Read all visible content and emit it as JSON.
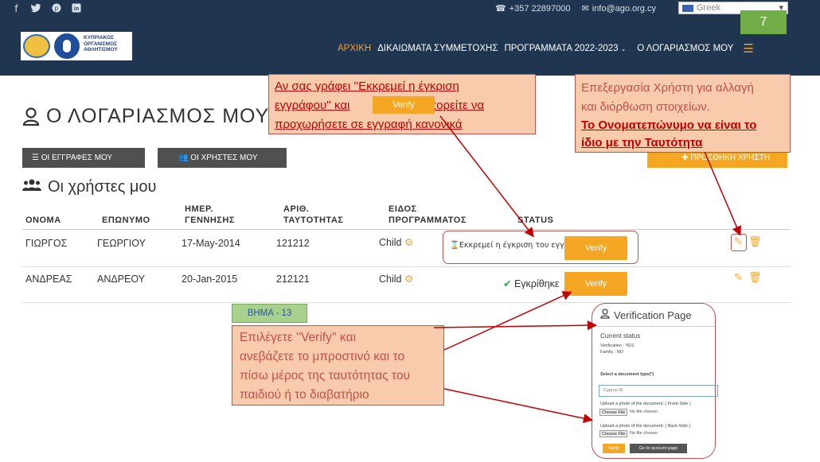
{
  "topbar": {
    "social": [
      "f",
      "🐦",
      "P",
      "in"
    ],
    "phone": "+357 22897000",
    "email": "info@ago.org.cy",
    "language": "Greek",
    "slide_number": "7"
  },
  "logo": {
    "text": "ΚΥΠΡΙΑΚΟΣ ΟΡΓΑΝΙΣΜΟΣ ΑΘΛΗΤΙΣΜΟΥ"
  },
  "nav": {
    "home": "ΑΡΧΙΚΗ",
    "rights": "ΔΙΚΑΙΩΜΑΤΑ ΣΥΜΜΕΤΟΧΗΣ",
    "programs": "ΠΡΟΓΡΑΜΜΑΤΑ 2022-2023",
    "account": "Ο ΛΟΓΑΡΙΑΣΜΟΣ ΜΟΥ"
  },
  "page": {
    "title": "Ο ΛΟΓΑΡΙΑΣΜΟΣ ΜΟΥ",
    "my_registrations": "ΟΙ ΕΓΓΡΑΦΕΣ ΜΟΥ",
    "my_users": "ΟΙ ΧΡΗΣΤΕΣ ΜΟΥ",
    "add_user": "ΠΡΟΣΘΗΚΗ ΧΡΗΣΤΗ",
    "section_title": "Οι χρήστες μου"
  },
  "table": {
    "headers": {
      "name": "ΟΝΟΜΑ",
      "surname": "ΕΠΩΝΥΜΟ",
      "birth1": "ΗΜΕΡ.",
      "birth2": "ΓΕΝΝΗΣΗΣ",
      "id1": "ΑΡΙΘ.",
      "id2": "ΤΑΥΤΟΤΗΤΑΣ",
      "program1": "ΕΙΔΟΣ",
      "program2": "ΠΡΟΓΡΑΜΜΑΤΟΣ",
      "status": "STATUS"
    },
    "rows": [
      {
        "name": "ΓΙΩΡΓΟΣ",
        "surname": "ΓΕΩΡΓΙΟΥ",
        "birth": "17-May-2014",
        "id": "121212",
        "program": "Child",
        "status": "Εκκρεμεί η έγκριση του εγγράφου",
        "verify": "Verify"
      },
      {
        "name": "ΑΝΔΡΕΑΣ",
        "surname": "ΑΝΔΡΕΟΥ",
        "birth": "20-Jan-2015",
        "id": "212121",
        "program": "Child",
        "status": "Εγκρίθηκε",
        "verify": "Verify"
      }
    ]
  },
  "callouts": {
    "c1_line1": "Αν σας γράφει ''Εκκρεμεί η έγκριση",
    "c1_line2a": "εγγράφου'' και",
    "c1_verify": "Verify",
    "c1_line2b": "μπορείτε να",
    "c1_line3": "προχωρήσετε σε εγγραφή κανονικά",
    "c2_line1": "Επεξεργασία Χρήστη για αλλαγή",
    "c2_line2": "και διόρθωση στοιχείων.",
    "c2_line3": "Το Ονοματεπώνυμο να είναι το",
    "c2_line4": "ίδιο με την Ταυτότητα",
    "c3_line1": "Επιλέγετε ''Verify'' και",
    "c3_line2": "ανεβάζετε το μπροστινό και το",
    "c3_line3": "πίσω μέρος της ταυτότητας του",
    "c3_line4": "παιδιού ή το διαβατήριο",
    "step": "ΒΗΜΑ - 13"
  },
  "verification": {
    "title": "Verification Page",
    "current_status": "Current status",
    "verification_line": "Verification : YES",
    "family_line": "Family : NO",
    "select_label": "Select a document type(*)",
    "select_value": "Cyprus ID",
    "front_label": "Upload a photo of the document: ( Front-Side )",
    "back_label": "Upload a photo of the document: ( Back-Side )",
    "choose_file": "Choose File",
    "no_file": "No file chosen",
    "verify_btn": "Verify",
    "account_btn": "Go to account page"
  },
  "colors": {
    "topbar": "#1f3550",
    "accent": "#f5a623",
    "callout_fill": "#f9cbad",
    "callout_border": "#c0504d",
    "step": "#a9d18e"
  }
}
